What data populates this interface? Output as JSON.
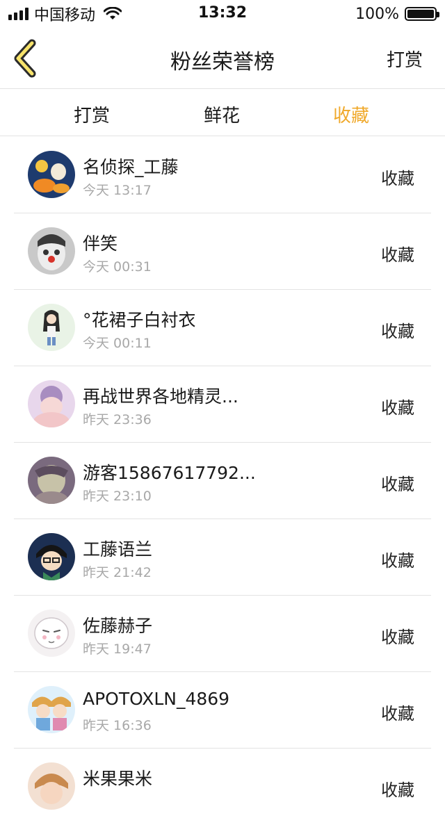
{
  "status_bar": {
    "carrier": "中国移动",
    "time": "13:32",
    "battery": "100%"
  },
  "nav": {
    "title": "粉丝荣誉榜",
    "right_action": "打赏"
  },
  "tabs": [
    {
      "label": "打赏",
      "active": false
    },
    {
      "label": "鲜花",
      "active": false
    },
    {
      "label": "收藏",
      "active": true
    }
  ],
  "accent_color": "#f0a92b",
  "fans": [
    {
      "name": "名侦探_工藤",
      "time": "今天 13:17",
      "action": "收藏"
    },
    {
      "name": "伴笑",
      "time": "今天 00:31",
      "action": "收藏"
    },
    {
      "name": "°花裙子白衬衣",
      "time": "今天 00:11",
      "action": "收藏"
    },
    {
      "name": "再战世界各地精灵...",
      "time": "昨天 23:36",
      "action": "收藏"
    },
    {
      "name": "游客15867617792...",
      "time": "昨天 23:10",
      "action": "收藏"
    },
    {
      "name": "工藤语兰",
      "time": "昨天 21:42",
      "action": "收藏"
    },
    {
      "name": "佐藤赫子",
      "time": "昨天 19:47",
      "action": "收藏"
    },
    {
      "name": "APOTOXLN_4869",
      "time": "昨天 16:36",
      "action": "收藏"
    },
    {
      "name": "米果果米",
      "time": "",
      "action": "收藏"
    }
  ]
}
